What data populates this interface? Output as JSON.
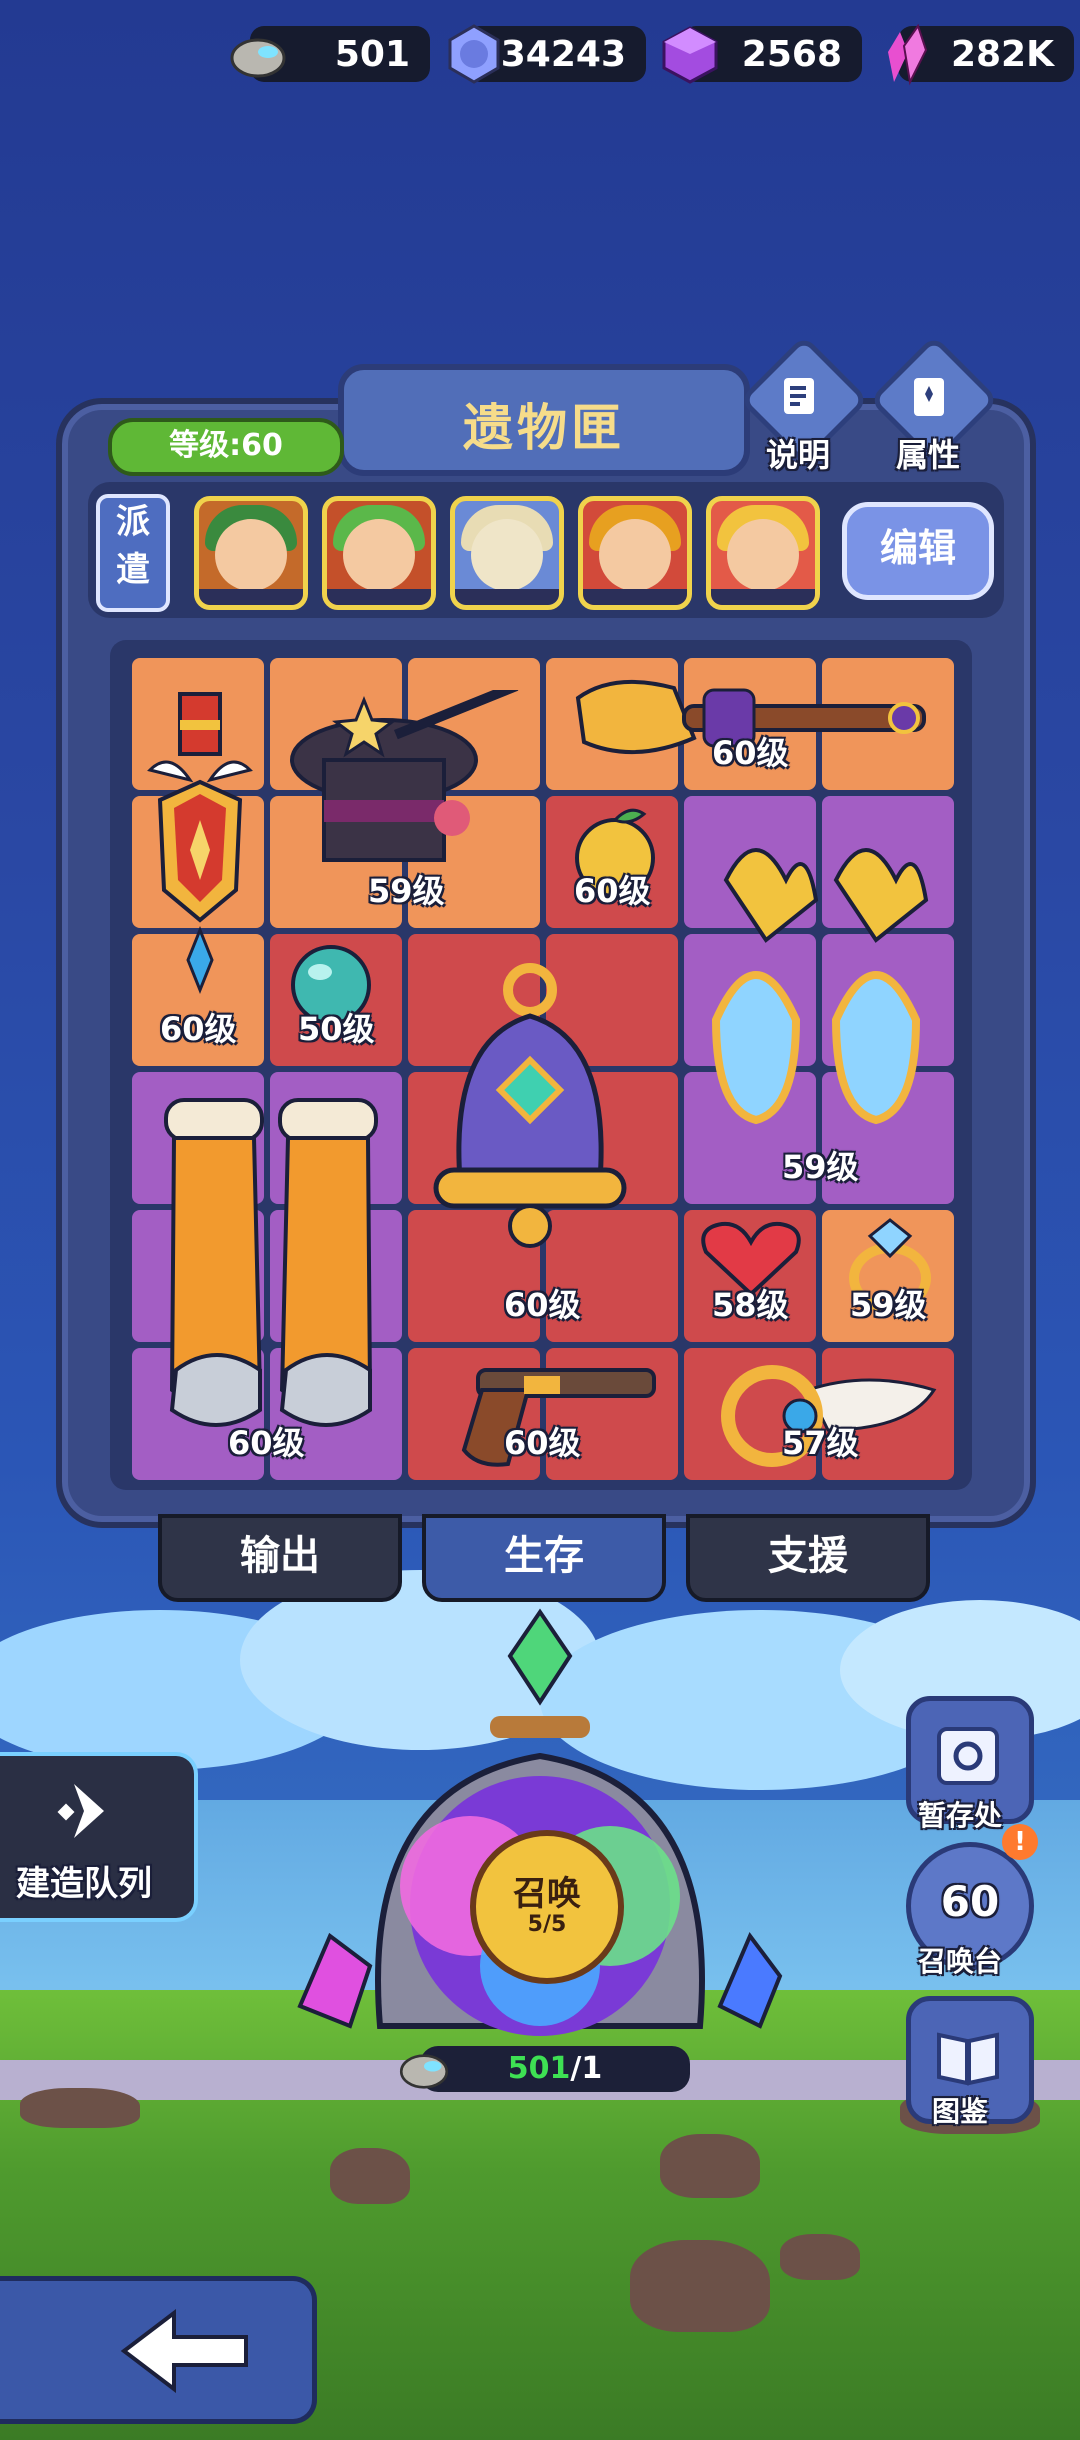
{
  "resources": [
    {
      "icon": "stone-icon",
      "value": "501"
    },
    {
      "icon": "gem-medal-icon",
      "value": "34243"
    },
    {
      "icon": "purple-cube-icon",
      "value": "2568"
    },
    {
      "icon": "crystal-icon",
      "value": "282K"
    }
  ],
  "panel": {
    "title": "遗物匣",
    "level": "等级:60",
    "help_label": "说明",
    "attr_label": "属性",
    "dispatch_label": "派遣",
    "edit_label": "编辑"
  },
  "heroes": [
    "hero-green-warrior",
    "hero-green-elf",
    "hero-mummy",
    "hero-fire-knight",
    "hero-fire-maiden"
  ],
  "items": [
    {
      "name": "medal",
      "level": "60级"
    },
    {
      "name": "magic-hat",
      "level": "59级"
    },
    {
      "name": "broom",
      "level": "60级"
    },
    {
      "name": "golden-apple",
      "level": "60级"
    },
    {
      "name": "crystal-orb",
      "level": "50级"
    },
    {
      "name": "crystal-earrings",
      "level": "59级"
    },
    {
      "name": "bell",
      "level": "60级"
    },
    {
      "name": "boots",
      "level": "60级"
    },
    {
      "name": "heart-gems",
      "level": "58级"
    },
    {
      "name": "diamond-ring",
      "level": "59级"
    },
    {
      "name": "pistol",
      "level": "60级"
    },
    {
      "name": "winged-ring",
      "level": "57级"
    }
  ],
  "tabs": [
    "输出",
    "生存",
    "支援"
  ],
  "active_tab": "生存",
  "build_queue_label": "建造队列",
  "side_buttons": {
    "storage": "暂存处",
    "summon_altar_level": "60",
    "summon_altar": "召唤台",
    "codex": "图鉴"
  },
  "summon": {
    "label": "召唤",
    "count": "5/5",
    "cost_have": "501",
    "cost_sep": "/",
    "cost_need": "1"
  },
  "colors": {
    "orange_cell": "#f0955a",
    "red_cell": "#cf4a4c",
    "purple_cell": "#a35ec4",
    "green_text": "#3ee053"
  }
}
